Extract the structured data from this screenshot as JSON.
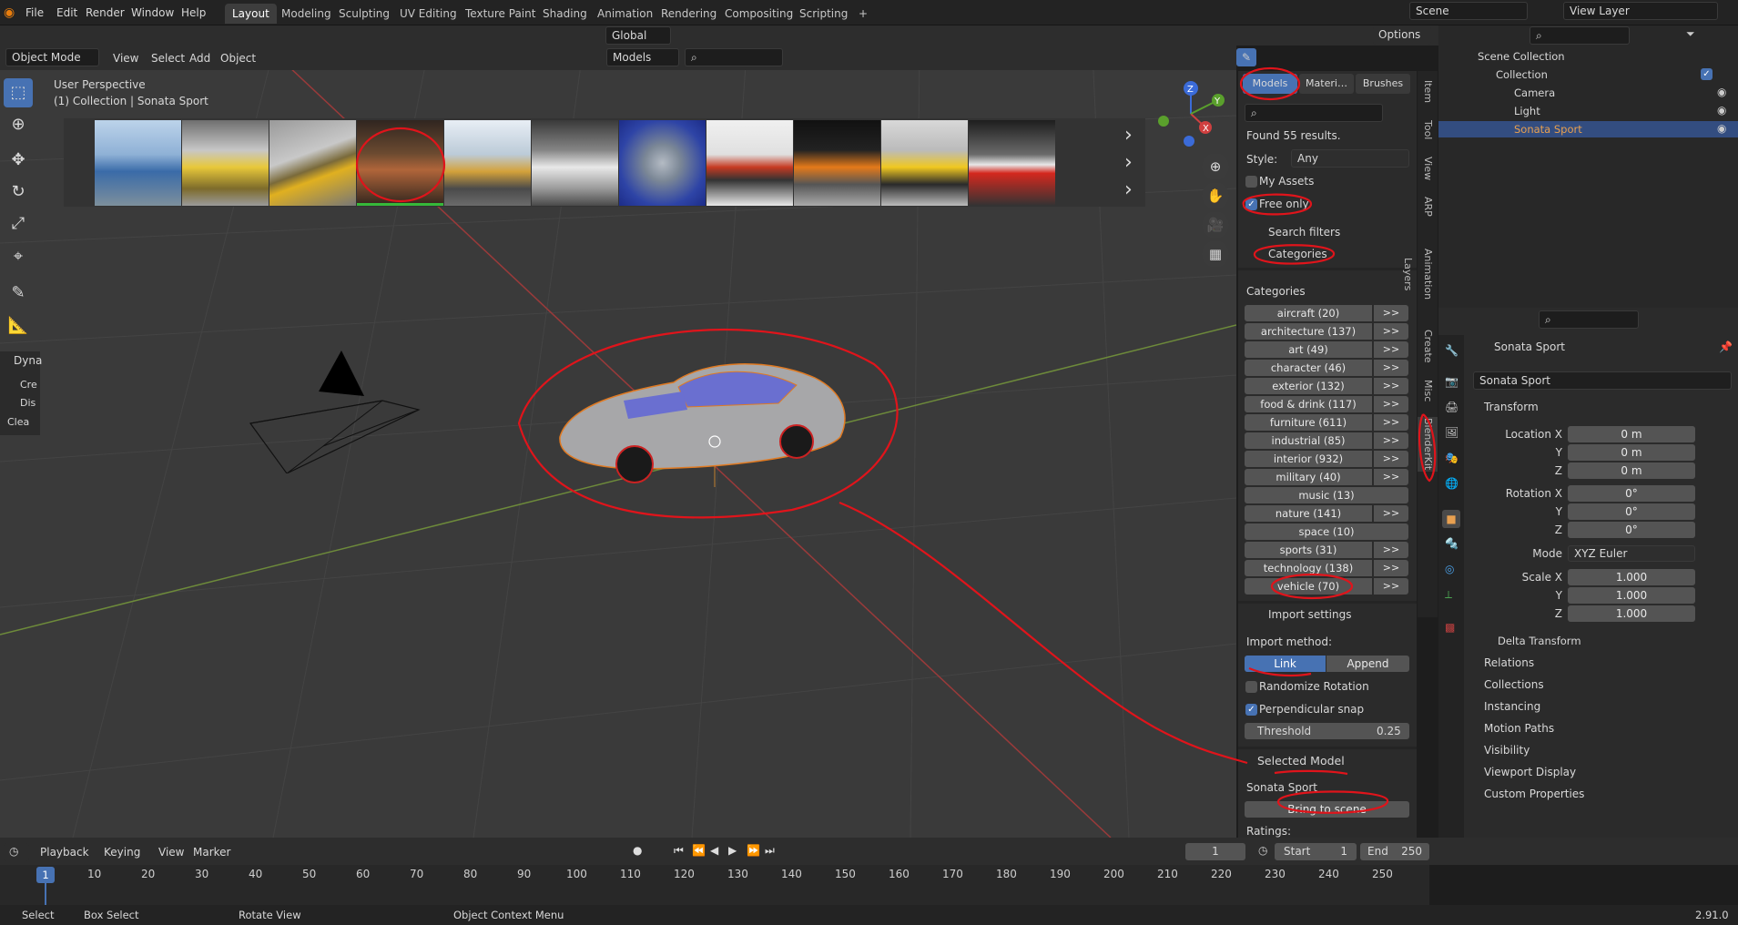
{
  "menus": [
    "File",
    "Edit",
    "Render",
    "Window",
    "Help"
  ],
  "workspaces": [
    "Layout",
    "Modeling",
    "Sculpting",
    "UV Editing",
    "Texture Paint",
    "Shading",
    "Animation",
    "Rendering",
    "Compositing",
    "Scripting"
  ],
  "active_workspace": "Layout",
  "scene_name": "Scene",
  "view_layer": "View Layer",
  "transform_orientation": "Global",
  "options_label": "Options",
  "viewport_header": {
    "mode": "Object Mode",
    "menus": [
      "View",
      "Select",
      "Add",
      "Object"
    ],
    "asset_type": "Models"
  },
  "viewport": {
    "perspective": "User Perspective",
    "collection_info": "(1) Collection | Sonata Sport"
  },
  "left_panel": {
    "title": "Dyna",
    "items": [
      "Cre",
      "Dis",
      "Clea"
    ]
  },
  "npanel": {
    "tabs": [
      "Models",
      "Materi…",
      "Brushes"
    ],
    "results": "Found 55 results.",
    "style_label": "Style:",
    "style_value": "Any",
    "my_assets": "My Assets",
    "free_only": "Free only",
    "search_filters": "Search filters",
    "categories_toggle": "Categories",
    "categories_heading": "Categories",
    "categories": [
      "aircraft (20)",
      "architecture (137)",
      "art (49)",
      "character (46)",
      "exterior (132)",
      "food & drink (117)",
      "furniture (611)",
      "industrial (85)",
      "interior (932)",
      "military (40)",
      "music (13)",
      "nature (141)",
      "space (10)",
      "sports (31)",
      "technology (138)",
      "vehicle (70)"
    ],
    "arrow": ">>",
    "import_settings": "Import settings",
    "import_method_label": "Import method:",
    "link": "Link",
    "append": "Append",
    "randomize_rotation": "Randomize Rotation",
    "perpendicular_snap": "Perpendicular snap",
    "threshold_label": "Threshold",
    "threshold_value": "0.25",
    "selected_model": "Selected Model",
    "model_name": "Sonata Sport",
    "bring_to_scene": "Bring to scene",
    "ratings": "Ratings:"
  },
  "side_tabs": [
    "Item",
    "Tool",
    "View",
    "ARP",
    "Animation Layers",
    "Create",
    "Misc",
    "BlenderKit"
  ],
  "outliner": {
    "root": "Scene Collection",
    "collection": "Collection",
    "items": [
      "Camera",
      "Light",
      "Sonata Sport"
    ]
  },
  "properties": {
    "object_name": "Sonata Sport",
    "data_name": "Sonata Sport",
    "transform": "Transform",
    "location_label": "Location X",
    "rotation_label": "Rotation X",
    "scale_label": "Scale X",
    "y": "Y",
    "z": "Z",
    "location": [
      "0 m",
      "0 m",
      "0 m"
    ],
    "rotation": [
      "0°",
      "0°",
      "0°"
    ],
    "mode_label": "Mode",
    "mode_value": "XYZ Euler",
    "scale": [
      "1.000",
      "1.000",
      "1.000"
    ],
    "delta_transform": "Delta Transform",
    "sections": [
      "Relations",
      "Collections",
      "Instancing",
      "Motion Paths",
      "Visibility",
      "Viewport Display",
      "Custom Properties"
    ]
  },
  "timeline": {
    "menus": [
      "Playback",
      "Keying",
      "View",
      "Marker"
    ],
    "current_frame": "1",
    "start_label": "Start",
    "start": "1",
    "end_label": "End",
    "end": "250",
    "ruler": [
      "1",
      "10",
      "20",
      "30",
      "40",
      "50",
      "60",
      "70",
      "80",
      "90",
      "100",
      "110",
      "120",
      "130",
      "140",
      "150",
      "160",
      "170",
      "180",
      "190",
      "200",
      "210",
      "220",
      "230",
      "240",
      "250"
    ]
  },
  "statusbar": {
    "select": "Select",
    "box_select": "Box Select",
    "rotate_view": "Rotate View",
    "context_menu": "Object Context Menu",
    "version": "2.91.0"
  },
  "colors": {
    "accent": "#4772b3",
    "annotation": "#e0141b",
    "viewport": "#3a3a3a",
    "panel": "#2b2b2b"
  }
}
